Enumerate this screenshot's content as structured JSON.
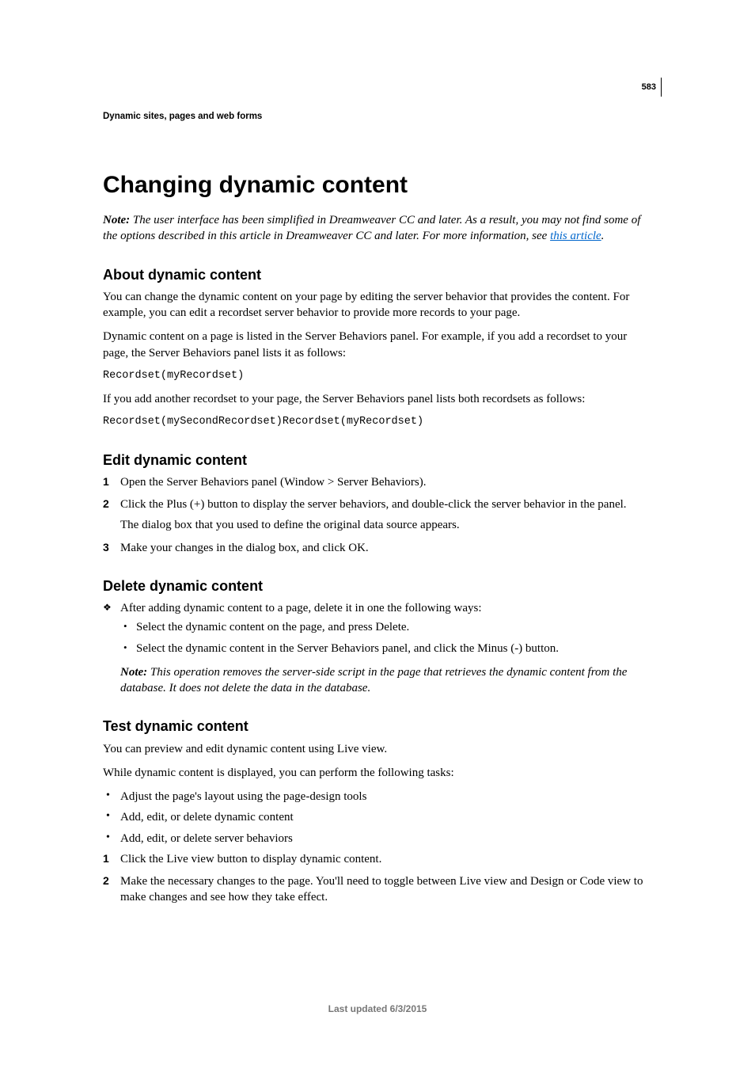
{
  "pageNumber": "583",
  "runningHead": "Dynamic sites, pages and web forms",
  "title": "Changing dynamic content",
  "topNote": {
    "label": "Note: ",
    "bodyBeforeLink": "The user interface has been simplified in Dreamweaver CC and later. As a result, you may not find some of the options described in this article in Dreamweaver CC and later. For more information, see ",
    "linkText": "this article",
    "bodyAfterLink": "."
  },
  "about": {
    "heading": "About dynamic content",
    "p1": "You can change the dynamic content on your page by editing the server behavior that provides the content. For example, you can edit a recordset server behavior to provide more records to your page.",
    "p2": "Dynamic content on a page is listed in the Server Behaviors panel. For example, if you add a recordset to your page, the Server Behaviors panel lists it as follows:",
    "code1": "Recordset(myRecordset)",
    "p3": "If you add another recordset to your page, the Server Behaviors panel lists both recordsets as follows:",
    "code2": "Recordset(mySecondRecordset)Recordset(myRecordset)"
  },
  "edit": {
    "heading": "Edit dynamic content",
    "steps": [
      {
        "n": "1",
        "text": "Open the Server Behaviors panel (Window > Server Behaviors)."
      },
      {
        "n": "2",
        "text": "Click the Plus (+) button to display the server behaviors, and double-click the server behavior in the panel.",
        "sub": "The dialog box that you used to define the original data source appears."
      },
      {
        "n": "3",
        "text": "Make your changes in the dialog box, and click OK."
      }
    ]
  },
  "delete": {
    "heading": "Delete dynamic content",
    "lead": "After adding dynamic content to a page, delete it in one the following ways:",
    "subitems": [
      "Select the dynamic content on the page, and press Delete.",
      "Select the dynamic content in the Server Behaviors panel, and click the Minus (-) button."
    ],
    "note": {
      "label": "Note: ",
      "body": "This operation removes the server-side script in the page that retrieves the dynamic content from the database. It does not delete the data in the database."
    }
  },
  "test": {
    "heading": "Test dynamic content",
    "p1": "You can preview and edit dynamic content using Live view.",
    "p2": "While dynamic content is displayed, you can perform the following tasks:",
    "bullets": [
      "Adjust the page's layout using the page-design tools",
      "Add, edit, or delete dynamic content",
      "Add, edit, or delete server behaviors"
    ],
    "steps": [
      {
        "n": "1",
        "text": "Click the Live view button to display dynamic content."
      },
      {
        "n": "2",
        "text": "Make the necessary changes to the page. You'll need to toggle between Live view and Design or Code view to make changes and see how they take effect."
      }
    ]
  },
  "footer": "Last updated 6/3/2015"
}
